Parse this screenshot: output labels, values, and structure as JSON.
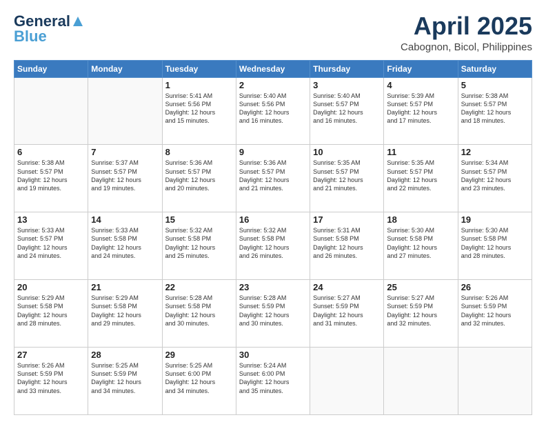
{
  "header": {
    "logo_line1": "General",
    "logo_line2": "Blue",
    "month": "April 2025",
    "location": "Cabognon, Bicol, Philippines"
  },
  "days_of_week": [
    "Sunday",
    "Monday",
    "Tuesday",
    "Wednesday",
    "Thursday",
    "Friday",
    "Saturday"
  ],
  "weeks": [
    [
      {
        "day": "",
        "info": ""
      },
      {
        "day": "",
        "info": ""
      },
      {
        "day": "1",
        "info": "Sunrise: 5:41 AM\nSunset: 5:56 PM\nDaylight: 12 hours\nand 15 minutes."
      },
      {
        "day": "2",
        "info": "Sunrise: 5:40 AM\nSunset: 5:56 PM\nDaylight: 12 hours\nand 16 minutes."
      },
      {
        "day": "3",
        "info": "Sunrise: 5:40 AM\nSunset: 5:57 PM\nDaylight: 12 hours\nand 16 minutes."
      },
      {
        "day": "4",
        "info": "Sunrise: 5:39 AM\nSunset: 5:57 PM\nDaylight: 12 hours\nand 17 minutes."
      },
      {
        "day": "5",
        "info": "Sunrise: 5:38 AM\nSunset: 5:57 PM\nDaylight: 12 hours\nand 18 minutes."
      }
    ],
    [
      {
        "day": "6",
        "info": "Sunrise: 5:38 AM\nSunset: 5:57 PM\nDaylight: 12 hours\nand 19 minutes."
      },
      {
        "day": "7",
        "info": "Sunrise: 5:37 AM\nSunset: 5:57 PM\nDaylight: 12 hours\nand 19 minutes."
      },
      {
        "day": "8",
        "info": "Sunrise: 5:36 AM\nSunset: 5:57 PM\nDaylight: 12 hours\nand 20 minutes."
      },
      {
        "day": "9",
        "info": "Sunrise: 5:36 AM\nSunset: 5:57 PM\nDaylight: 12 hours\nand 21 minutes."
      },
      {
        "day": "10",
        "info": "Sunrise: 5:35 AM\nSunset: 5:57 PM\nDaylight: 12 hours\nand 21 minutes."
      },
      {
        "day": "11",
        "info": "Sunrise: 5:35 AM\nSunset: 5:57 PM\nDaylight: 12 hours\nand 22 minutes."
      },
      {
        "day": "12",
        "info": "Sunrise: 5:34 AM\nSunset: 5:57 PM\nDaylight: 12 hours\nand 23 minutes."
      }
    ],
    [
      {
        "day": "13",
        "info": "Sunrise: 5:33 AM\nSunset: 5:57 PM\nDaylight: 12 hours\nand 24 minutes."
      },
      {
        "day": "14",
        "info": "Sunrise: 5:33 AM\nSunset: 5:58 PM\nDaylight: 12 hours\nand 24 minutes."
      },
      {
        "day": "15",
        "info": "Sunrise: 5:32 AM\nSunset: 5:58 PM\nDaylight: 12 hours\nand 25 minutes."
      },
      {
        "day": "16",
        "info": "Sunrise: 5:32 AM\nSunset: 5:58 PM\nDaylight: 12 hours\nand 26 minutes."
      },
      {
        "day": "17",
        "info": "Sunrise: 5:31 AM\nSunset: 5:58 PM\nDaylight: 12 hours\nand 26 minutes."
      },
      {
        "day": "18",
        "info": "Sunrise: 5:30 AM\nSunset: 5:58 PM\nDaylight: 12 hours\nand 27 minutes."
      },
      {
        "day": "19",
        "info": "Sunrise: 5:30 AM\nSunset: 5:58 PM\nDaylight: 12 hours\nand 28 minutes."
      }
    ],
    [
      {
        "day": "20",
        "info": "Sunrise: 5:29 AM\nSunset: 5:58 PM\nDaylight: 12 hours\nand 28 minutes."
      },
      {
        "day": "21",
        "info": "Sunrise: 5:29 AM\nSunset: 5:58 PM\nDaylight: 12 hours\nand 29 minutes."
      },
      {
        "day": "22",
        "info": "Sunrise: 5:28 AM\nSunset: 5:58 PM\nDaylight: 12 hours\nand 30 minutes."
      },
      {
        "day": "23",
        "info": "Sunrise: 5:28 AM\nSunset: 5:59 PM\nDaylight: 12 hours\nand 30 minutes."
      },
      {
        "day": "24",
        "info": "Sunrise: 5:27 AM\nSunset: 5:59 PM\nDaylight: 12 hours\nand 31 minutes."
      },
      {
        "day": "25",
        "info": "Sunrise: 5:27 AM\nSunset: 5:59 PM\nDaylight: 12 hours\nand 32 minutes."
      },
      {
        "day": "26",
        "info": "Sunrise: 5:26 AM\nSunset: 5:59 PM\nDaylight: 12 hours\nand 32 minutes."
      }
    ],
    [
      {
        "day": "27",
        "info": "Sunrise: 5:26 AM\nSunset: 5:59 PM\nDaylight: 12 hours\nand 33 minutes."
      },
      {
        "day": "28",
        "info": "Sunrise: 5:25 AM\nSunset: 5:59 PM\nDaylight: 12 hours\nand 34 minutes."
      },
      {
        "day": "29",
        "info": "Sunrise: 5:25 AM\nSunset: 6:00 PM\nDaylight: 12 hours\nand 34 minutes."
      },
      {
        "day": "30",
        "info": "Sunrise: 5:24 AM\nSunset: 6:00 PM\nDaylight: 12 hours\nand 35 minutes."
      },
      {
        "day": "",
        "info": ""
      },
      {
        "day": "",
        "info": ""
      },
      {
        "day": "",
        "info": ""
      }
    ]
  ]
}
